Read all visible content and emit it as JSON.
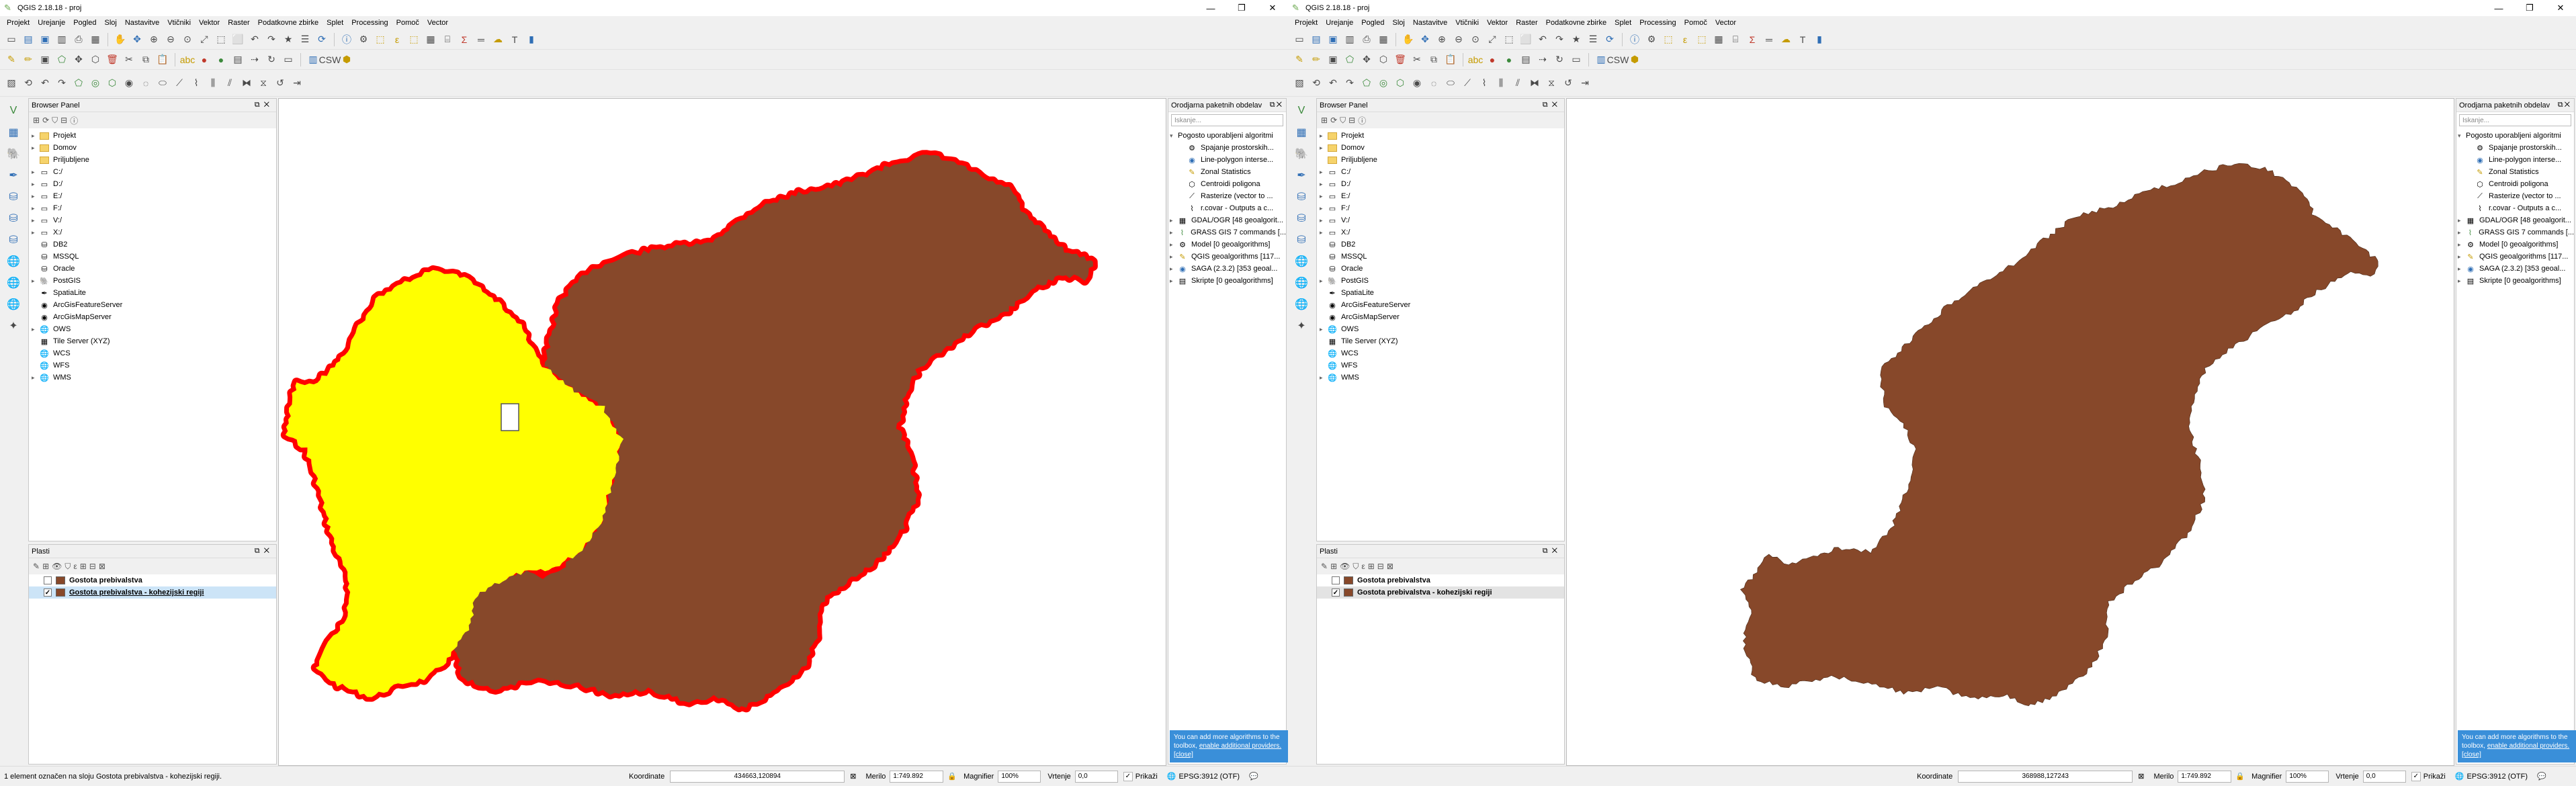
{
  "left": {
    "title": "QGIS 2.18.18 - proj",
    "menu": [
      "Projekt",
      "Urejanje",
      "Pogled",
      "Sloj",
      "Nastavitve",
      "Vtičniki",
      "Vektor",
      "Raster",
      "Podatkovne zbirke",
      "Splet",
      "Processing",
      "Pomoč",
      "Vector"
    ],
    "browser_title": "Browser Panel",
    "browser_items": [
      "Projekt",
      "Domov",
      "Priljubljene",
      "C:/",
      "D:/",
      "E:/",
      "F:/",
      "V:/",
      "X:/",
      "DB2",
      "MSSQL",
      "Oracle",
      "PostGIS",
      "SpatiaLite",
      "ArcGisFeatureServer",
      "ArcGisMapServer",
      "OWS",
      "Tile Server (XYZ)",
      "WCS",
      "WFS",
      "WMS"
    ],
    "layers_title": "Plasti",
    "layers": [
      "Gostota prebivalstva",
      "Gostota prebivalstva - kohezijski regiji"
    ],
    "toolbox_title": "Orodjarna paketnih obdelav",
    "toolbox_search": "Iskanje...",
    "toolbox_items": [
      "Pogosto uporabljeni algoritmi",
      "Spajanje prostorskih...",
      "Line-polygon interse...",
      "Zonal Statistics",
      "Centroidi poligona",
      "Rasterize (vector to ...",
      "r.covar - Outputs a c...",
      "GDAL/OGR [48 geoalgorit...",
      "GRASS GIS 7 commands [...",
      "Model [0 geoalgorithms]",
      "QGIS geoalgorithms [117...",
      "SAGA (2.3.2) [353 geoal...",
      "Skripte [0 geoalgorithms]"
    ],
    "notice_text": "You can add more algorithms to the toolbox,",
    "notice_link": "enable additional providers.",
    "notice_close": "[close]",
    "status_msg": "1 element označen na sloju Gostota prebivalstva - kohezijski regiji.",
    "coord_label": "Koordinate",
    "coord_value": "434663,120894",
    "scale_label": "Merilo",
    "scale_value": "1:749.892",
    "magnifier_label": "Magnifier",
    "magnifier_value": "100%",
    "rotation_label": "Vrtenje",
    "rotation_value": "0,0",
    "render_label": "Prikaži",
    "crs_label": "EPSG:3912 (OTF)"
  },
  "right": {
    "title": "QGIS 2.18.18 - proj",
    "menu": [
      "Projekt",
      "Urejanje",
      "Pogled",
      "Sloj",
      "Nastavitve",
      "Vtičniki",
      "Vektor",
      "Raster",
      "Podatkovne zbirke",
      "Splet",
      "Processing",
      "Pomoč",
      "Vector"
    ],
    "browser_title": "Browser Panel",
    "browser_items": [
      "Projekt",
      "Domov",
      "Priljubljene",
      "C:/",
      "D:/",
      "E:/",
      "F:/",
      "V:/",
      "X:/",
      "DB2",
      "MSSQL",
      "Oracle",
      "PostGIS",
      "SpatiaLite",
      "ArcGisFeatureServer",
      "ArcGisMapServer",
      "OWS",
      "Tile Server (XYZ)",
      "WCS",
      "WFS",
      "WMS"
    ],
    "layers_title": "Plasti",
    "layers": [
      "Gostota prebivalstva",
      "Gostota prebivalstva - kohezijski regiji"
    ],
    "toolbox_title": "Orodjarna paketnih obdelav",
    "toolbox_search": "Iskanje...",
    "toolbox_items": [
      "Pogosto uporabljeni algoritmi",
      "Spajanje prostorskih...",
      "Line-polygon interse...",
      "Zonal Statistics",
      "Centroidi poligona",
      "Rasterize (vector to ...",
      "r.covar - Outputs a c...",
      "GDAL/OGR [48 geoalgorit...",
      "GRASS GIS 7 commands [...",
      "Model [0 geoalgorithms]",
      "QGIS geoalgorithms [117...",
      "SAGA (2.3.2) [353 geoal...",
      "Skripte [0 geoalgorithms]"
    ],
    "notice_text": "You can add more algorithms to the toolbox,",
    "notice_link": "enable additional providers.",
    "notice_close": "[close]",
    "status_msg": "",
    "coord_label": "Koordinate",
    "coord_value": "368988,127243",
    "scale_label": "Merilo",
    "scale_value": "1:749.892",
    "magnifier_label": "Magnifier",
    "magnifier_value": "100%",
    "rotation_label": "Vrtenje",
    "rotation_value": "0,0",
    "render_label": "Prikaži",
    "crs_label": "EPSG:3912 (OTF)"
  },
  "colors": {
    "region_brown": "#87482a",
    "region_yellow": "#ffff00",
    "selection_red": "#ff0000",
    "notice_blue": "#3a8fd9"
  }
}
